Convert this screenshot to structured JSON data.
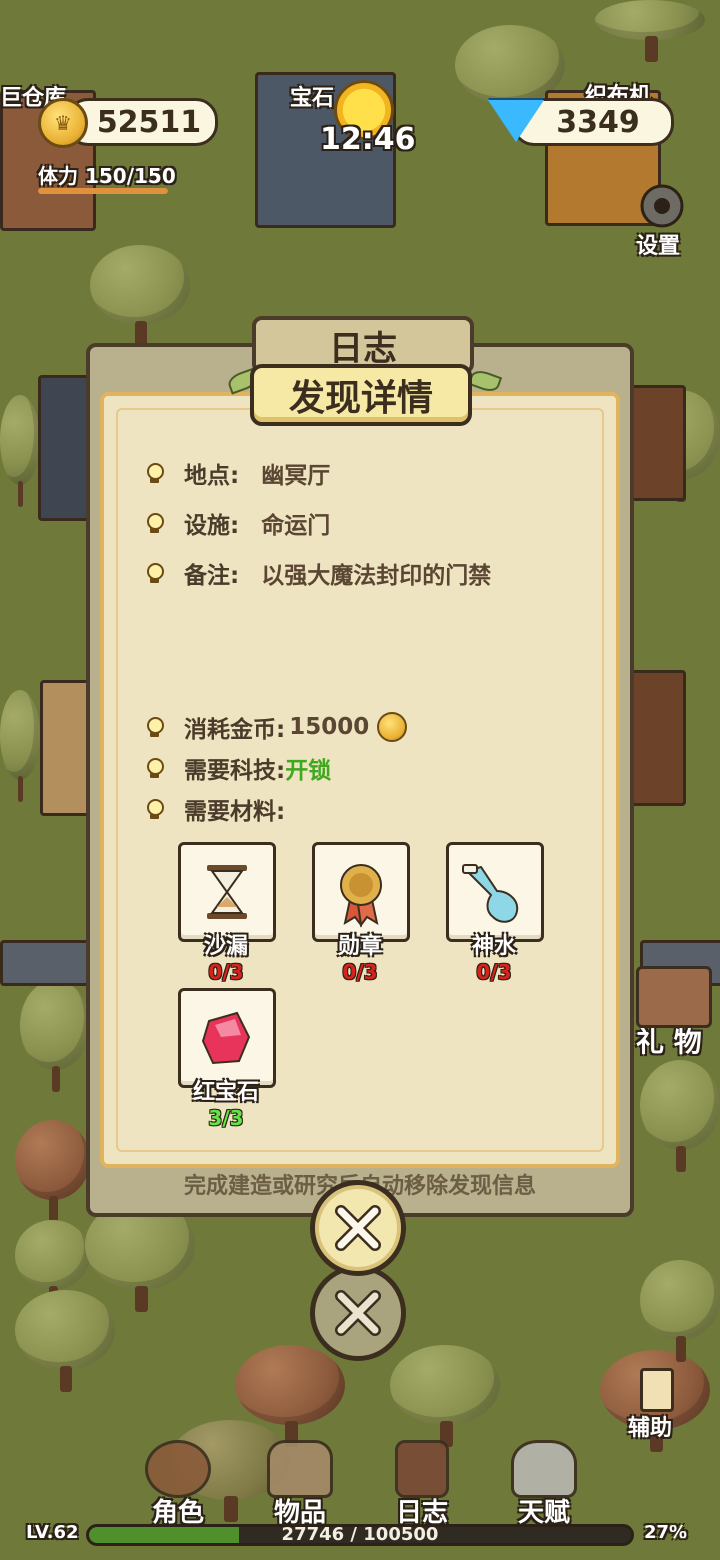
{
  "hud": {
    "coins": "52511",
    "stamina": "体力 150/150",
    "stamina_fraction": 1.0,
    "clock": "12:46",
    "gems": "3349",
    "settings_label": "设置"
  },
  "map_labels": {
    "warehouse": "巨仓库",
    "gem": "宝石",
    "loom": "织布机",
    "gift": "礼 物",
    "assist": "辅助"
  },
  "dialog": {
    "back_title": "日志",
    "title": "发现详情",
    "fields": [
      {
        "key": "地点:",
        "value": "幽冥厅"
      },
      {
        "key": "设施:",
        "value": "命运门"
      },
      {
        "key": "备注:",
        "value": "以强大魔法封印的门禁"
      }
    ],
    "cost_key": "消耗金币:",
    "cost_value": "15000",
    "tech_key": "需要科技:",
    "tech_value": "开锁",
    "materials_key": "需要材料:",
    "materials": [
      {
        "name": "沙漏",
        "count": "0/3",
        "icon": "hourglass-icon"
      },
      {
        "name": "勋章",
        "count": "0/3",
        "icon": "medal-icon"
      },
      {
        "name": "神水",
        "count": "0/3",
        "icon": "potion-icon"
      },
      {
        "name": "红宝石",
        "count": "3/3",
        "icon": "ruby-icon"
      }
    ],
    "note": "完成建造或研究后自动移除发现信息"
  },
  "nav": [
    {
      "label": "角色"
    },
    {
      "label": "物品"
    },
    {
      "label": "日志"
    },
    {
      "label": "天赋"
    }
  ],
  "level": {
    "label": "LV.62",
    "xp": "27746 / 100500",
    "percent": "27%",
    "fraction": 0.276
  }
}
